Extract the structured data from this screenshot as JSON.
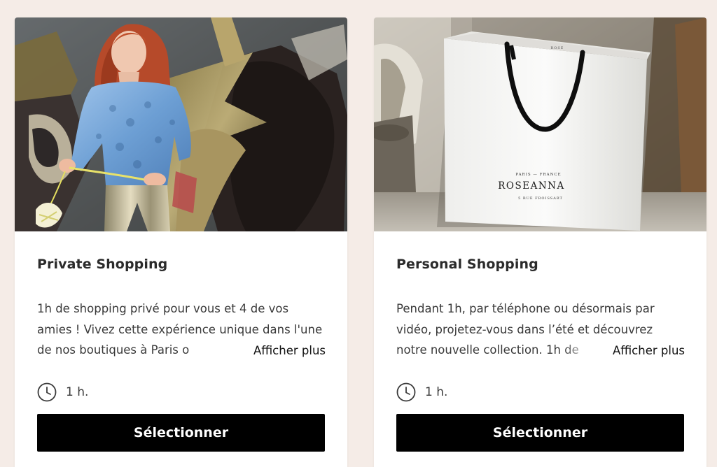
{
  "cards": [
    {
      "title": "Private Shopping",
      "description": "1h de shopping privé pour vous et 4 de vos amies ! Vivez cette expérience unique dans l'une de nos boutiques à Paris o",
      "more_label": "Afficher plus",
      "duration": "1 h.",
      "duration_icon": "clock-icon",
      "button_label": "Sélectionner",
      "image": "woman-in-lace-blouse-and-metallic-pants-photo"
    },
    {
      "title": "Personal Shopping",
      "description": "Pendant 1h, par téléphone ou désormais par vidéo, projetez-vous dans l’été et découvrez notre nouvelle collection. 1h de",
      "more_label": "Afficher plus",
      "duration": "1 h.",
      "duration_icon": "clock-icon",
      "button_label": "Sélectionner",
      "image": "white-shopping-bag-photo",
      "bag_brand": "ROSEANNA",
      "bag_top": "PARIS — FRANCE",
      "bag_bottom": "5 RUE FROISSART",
      "bag_small": "ROSE"
    }
  ],
  "colors": {
    "page_background": "#f5ece7",
    "card_background": "#ffffff",
    "button_background": "#000000",
    "button_text": "#ffffff",
    "title_text": "#2b2b2b"
  }
}
